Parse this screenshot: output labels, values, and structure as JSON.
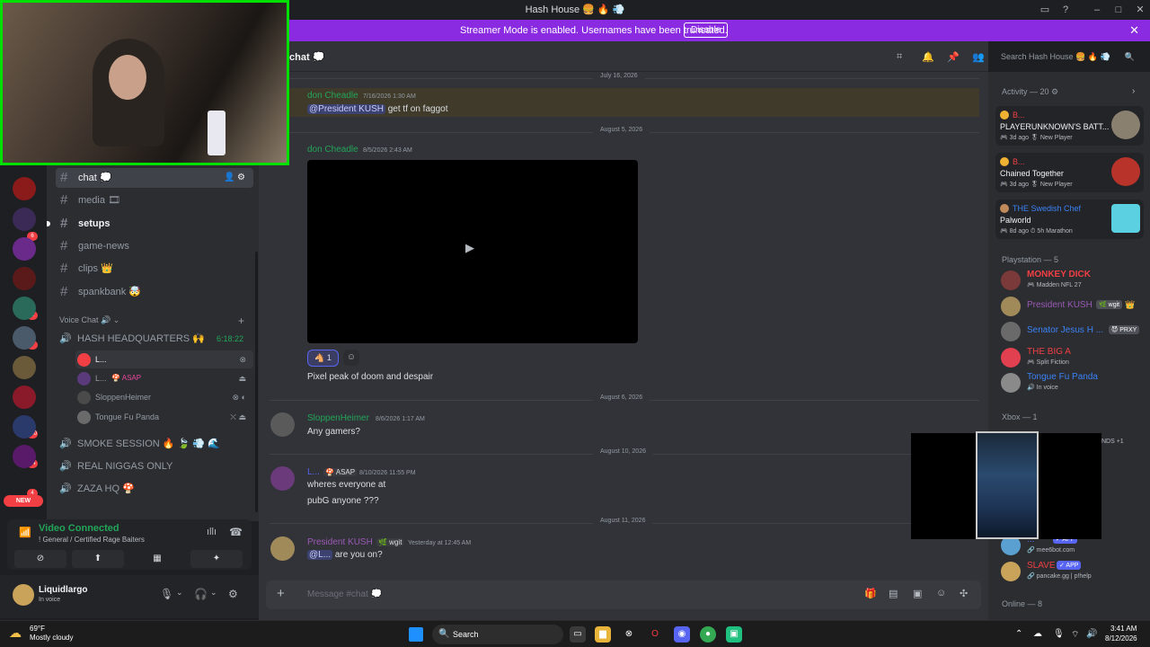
{
  "window": {
    "title": "Hash House 🍔 🔥 💨"
  },
  "banner": {
    "text": "Streamer Mode is enabled. Usernames have been truncated.",
    "disable": "Disable",
    "close": "✕"
  },
  "servers": {
    "badges": [
      "6",
      "1",
      "7",
      "180",
      "84",
      "4"
    ],
    "new_label": "NEW"
  },
  "channels": {
    "text": [
      {
        "name": "chat 💭"
      },
      {
        "name": "media 🎞"
      },
      {
        "name": "setups"
      },
      {
        "name": "game-news"
      },
      {
        "name": "clips 👑"
      },
      {
        "name": "spankbank 🤯"
      }
    ],
    "voice_category": "Voice Chat 🔊",
    "voice": [
      {
        "name": "HASH HEADQUARTERS 🙌"
      },
      {
        "name": "SMOKE SESSION 🔥 🍃 💨 🌊"
      },
      {
        "name": "REAL NIGGAS ONLY"
      },
      {
        "name": "ZAZA HQ 🍄"
      }
    ],
    "voice_timer": "6:18:22",
    "voice_users": [
      {
        "name": "L...",
        "tag": ""
      },
      {
        "name": "L...",
        "tag": "🍄 ASAP"
      },
      {
        "name": "SloppenHeimer",
        "tag": ""
      },
      {
        "name": "Tongue Fu Panda",
        "tag": ""
      }
    ]
  },
  "rtc": {
    "title": "Video Connected",
    "subtitle": "! General / Certified Rage Baiters"
  },
  "user": {
    "name": "Liquidlargo",
    "status": "In voice"
  },
  "header": {
    "channel": "chat 💭",
    "search_placeholder": "Search Hash House 🍔 🔥 💨"
  },
  "messages": {
    "dividers": [
      "July 16, 2026",
      "August 5, 2026",
      "August 6, 2026",
      "August 10, 2026",
      "August 11, 2026"
    ],
    "items": [
      {
        "author": "don Cheadle",
        "time": "7/16/2026 1:30 AM",
        "mention": "@President KUSH",
        "text": "get tf on faggot"
      },
      {
        "author": "don Cheadle",
        "time": "8/5/2026 2:43 AM",
        "text": "Pixel peak of doom and despair",
        "reaction_count": "1"
      },
      {
        "author": "SloppenHeimer",
        "time": "8/6/2026 1:17 AM",
        "text": "Any gamers?"
      },
      {
        "author": "L...",
        "tag": "🍄 ASAP",
        "time": "8/10/2026 11:55 PM",
        "text": "wheres everyone at",
        "text2": "pubG anyone ???"
      },
      {
        "author": "President KUSH",
        "tag": "🌿 wgit",
        "time": "Yesterday at 12:45 AM",
        "mention": "@L...",
        "text": "are you on?"
      }
    ]
  },
  "composer": {
    "placeholder": "Message #chat 💭"
  },
  "members": {
    "activity_title": "Activity — 20 ⚙",
    "activities": [
      {
        "name": "B...",
        "game": "PLAYERUNKNOWN'S BATT...",
        "meta": "🎮 3d ago  🎖 New Player"
      },
      {
        "name": "B...",
        "game": "Chained Together",
        "meta": "🎮 3d ago  🎖 New Player"
      },
      {
        "name": "THE Swedish Chef",
        "game": "Palworld",
        "meta": "🎮 8d ago  ⏱ 5h Marathon"
      }
    ],
    "playstation_title": "Playstation — 5",
    "playstation": [
      {
        "name": "MONKEY DICK",
        "status": "🎮 Madden NFL 27",
        "tag": "",
        "color": "#f23f43"
      },
      {
        "name": "President KUSH",
        "status": "",
        "tag": "🌿 wgit",
        "color": "#9b59b6"
      },
      {
        "name": "Senator Jesus H ...",
        "status": "",
        "tag": "😈 PRXY",
        "color": "#3b82f6"
      },
      {
        "name": "THE BIG A",
        "status": "🎮 Split Fiction",
        "tag": "",
        "color": "#f23f43"
      },
      {
        "name": "Tongue Fu Panda",
        "status": "🔊 In voice",
        "tag": "",
        "color": "#3b82f6"
      }
    ],
    "xbox_title": "Xbox — 1",
    "xbox_partial": "NDS +1",
    "apps": [
      {
        "name": "...",
        "status": "🔗 mee6bot.com",
        "tag": "✓ APP"
      },
      {
        "name": "SLAVE",
        "status": "🔗 pancake.gg | p!help",
        "tag": "✓ APP"
      }
    ],
    "online_title": "Online — 8"
  },
  "taskbar": {
    "temp": "69°F",
    "weather": "Mostly cloudy",
    "search": "Search",
    "time": "3:41 AM",
    "date": "8/12/2026"
  }
}
